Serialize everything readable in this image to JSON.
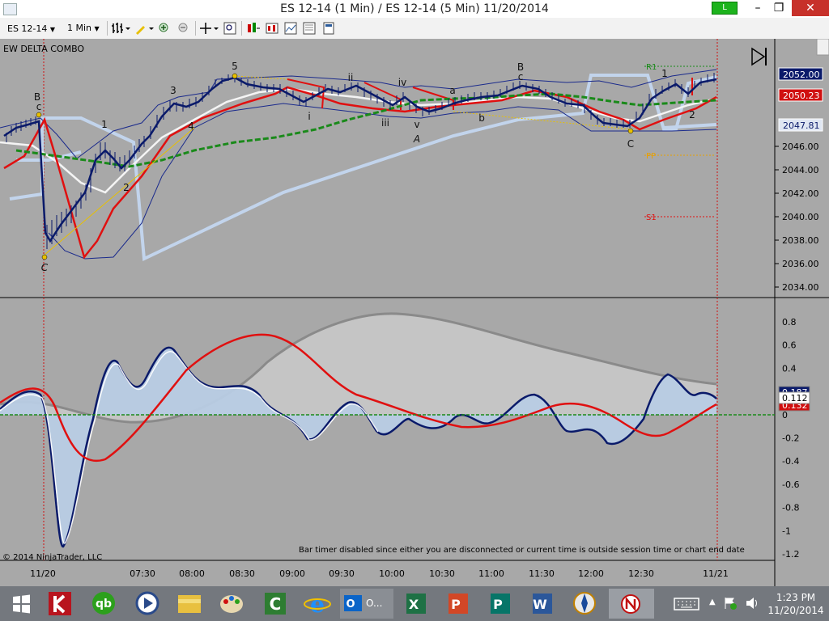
{
  "window": {
    "title": "ES 12-14 (1 Min) / ES 12-14 (5 Min)  11/20/2014",
    "status_indicator": "L",
    "minimize": "–",
    "restore": "❐",
    "close": "✕"
  },
  "toolbar": {
    "instrument": "ES 12-14",
    "interval": "1 Min"
  },
  "chart": {
    "indicator_label": "EW DELTA COMBO",
    "copyright": "© 2014 NinjaTrader, LLC",
    "bar_timer_message": "Bar timer disabled since either you are disconnected or current time is outside session time or chart end date",
    "price_axis_ticks": [
      "2046.00",
      "2044.00",
      "2042.00",
      "2040.00",
      "2038.00",
      "2036.00",
      "2034.00"
    ],
    "price_tags": [
      "2052.00",
      "2050.23",
      "2047.81"
    ],
    "osc_axis_ticks": [
      "0.8",
      "0.6",
      "0.4",
      "0.2",
      "0",
      "-0.2",
      "-0.4",
      "-0.6",
      "-0.8",
      "-1",
      "-1.2"
    ],
    "osc_tags": [
      "0.187",
      "0.132",
      "0.112"
    ],
    "time_ticks": [
      "11/20",
      "07:30",
      "08:00",
      "08:30",
      "09:00",
      "09:30",
      "10:00",
      "10:30",
      "11:00",
      "11:30",
      "12:00",
      "12:30",
      "11/21"
    ],
    "wave_labels": [
      "B",
      "c",
      "C",
      "1",
      "2",
      "3",
      "4",
      "5",
      "ii",
      "i",
      "iii",
      "iv",
      "v",
      "A",
      "a",
      "b",
      "B",
      "c",
      "C",
      "1",
      "2"
    ],
    "pivot_labels": [
      "R1",
      "PP",
      "S1"
    ],
    "colors": {
      "background": "#a8a8a8",
      "price_band": "#1a2a8c",
      "red_ma": "#e01010",
      "white_ma": "#ffffff",
      "green_ma": "#1a8a1a",
      "light_blue_band": "#c2d4ec",
      "osc_fill": "#b8cce4",
      "osc_gray": "#c8c8c8",
      "tag_navy": "#0a1a6a",
      "tag_red": "#d01010"
    }
  },
  "taskbar": {
    "outlook_label": "O...",
    "time": "1:23 PM",
    "date": "11/20/2014"
  }
}
